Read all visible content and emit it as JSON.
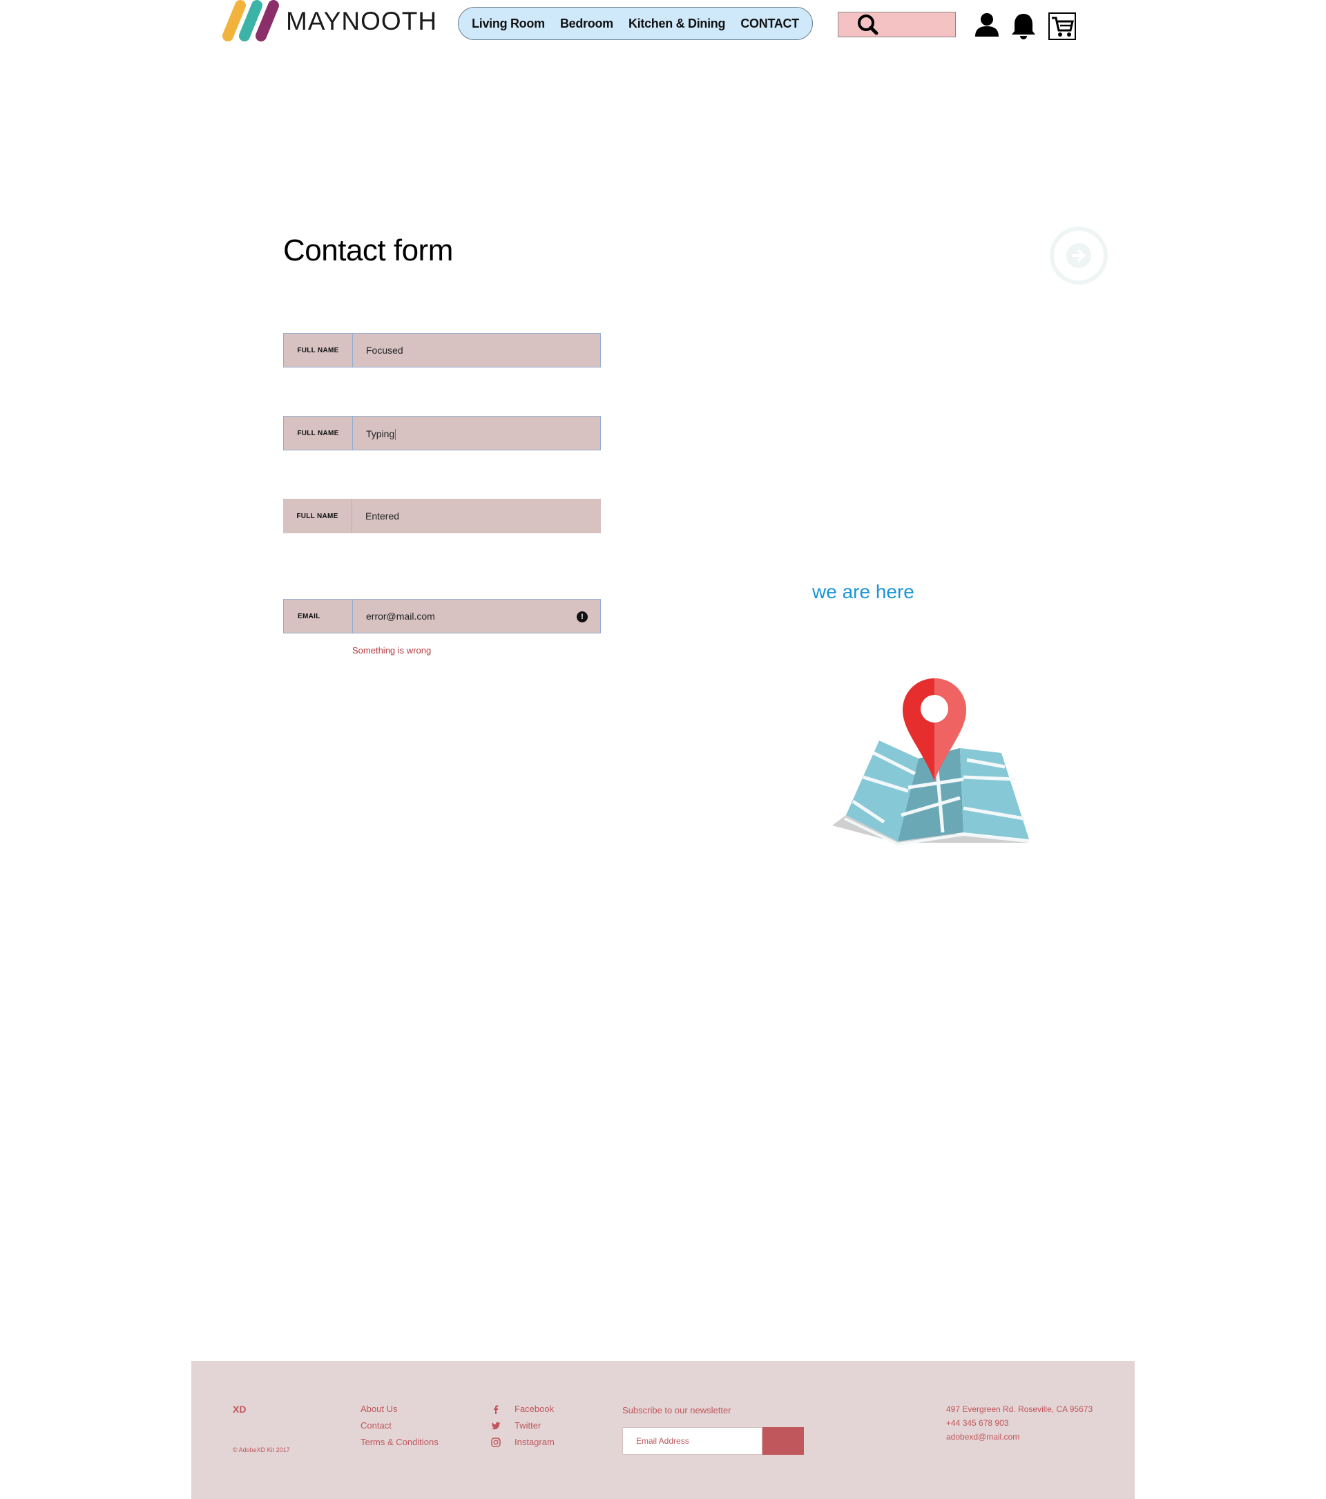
{
  "header": {
    "brand": "MAYNOOTH",
    "nav": [
      {
        "label": "Living Room"
      },
      {
        "label": "Bedroom"
      },
      {
        "label": "Kitchen & Dining"
      },
      {
        "label": "CONTACT"
      }
    ],
    "icons": [
      "search-icon",
      "user-icon",
      "bell-icon",
      "cart-icon"
    ]
  },
  "form": {
    "title": "Contact form",
    "fields": [
      {
        "label": "FULL NAME",
        "value": "Focused",
        "state": "focused"
      },
      {
        "label": "FULL NAME",
        "value": "Typing",
        "state": "typing"
      },
      {
        "label": "FULL NAME",
        "value": "Entered",
        "state": "entered"
      },
      {
        "label": "EMAIL",
        "value": "error@mail.com",
        "state": "error"
      }
    ],
    "error_message": "Something is wrong"
  },
  "location": {
    "heading": "we are here"
  },
  "footer": {
    "brand": "XD",
    "copyright": "© AdobeXD Kit 2017",
    "links": [
      "About Us",
      "Contact",
      "Terms & Conditions"
    ],
    "social": [
      {
        "label": "Facebook",
        "icon": "facebook-icon"
      },
      {
        "label": "Twitter",
        "icon": "twitter-icon"
      },
      {
        "label": "Instagram",
        "icon": "instagram-icon"
      }
    ],
    "newsletter": {
      "title": "Subscribe to our newsletter",
      "placeholder": "Email Address"
    },
    "address": {
      "street": "497 Evergreen Rd. Roseville, CA 95673",
      "phone": "+44 345 678 903",
      "email": "adobexd@mail.com"
    }
  },
  "colors": {
    "nav_bg": "#cfe9fb",
    "search_bg": "#f5c2c4",
    "field_bg": "#d7c1c1",
    "accent": "#c0575c",
    "heading_blue": "#1a95d8",
    "footer_bg": "#e3d4d5"
  }
}
